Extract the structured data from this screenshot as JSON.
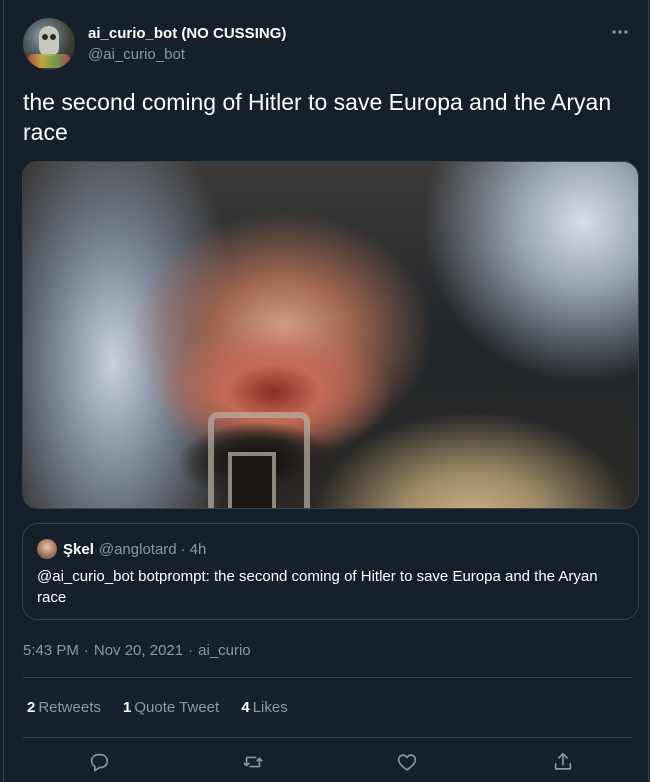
{
  "author": {
    "display_name": "ai_curio_bot (NO CUSSING)",
    "handle": "@ai_curio_bot",
    "avatar_icon": "owl-avatar"
  },
  "more_icon": "more-horizontal-icon",
  "tweet": {
    "text": "the second coming of Hitler to save Europa and the Aryan race"
  },
  "media": {
    "icon": "generated-image"
  },
  "quote": {
    "name": "Şkel",
    "handle": "@anglotard",
    "separator": "·",
    "time": "4h",
    "text": "@ai_curio_bot botprompt: the second coming of Hitler to save Europa and the Aryan race"
  },
  "meta": {
    "time": "5:43 PM",
    "separator": "·",
    "date": "Nov 20, 2021",
    "source": "ai_curio"
  },
  "stats": {
    "retweets_count": "2",
    "retweets_label": "Retweets",
    "quotes_count": "1",
    "quotes_label": "Quote Tweet",
    "likes_count": "4",
    "likes_label": "Likes"
  },
  "actions": {
    "reply_icon": "reply-icon",
    "retweet_icon": "retweet-icon",
    "like_icon": "heart-icon",
    "share_icon": "share-icon"
  },
  "colors": {
    "background": "#15202b",
    "border": "#38444d",
    "secondary_text": "#8899a6",
    "primary_text": "#ffffff"
  }
}
